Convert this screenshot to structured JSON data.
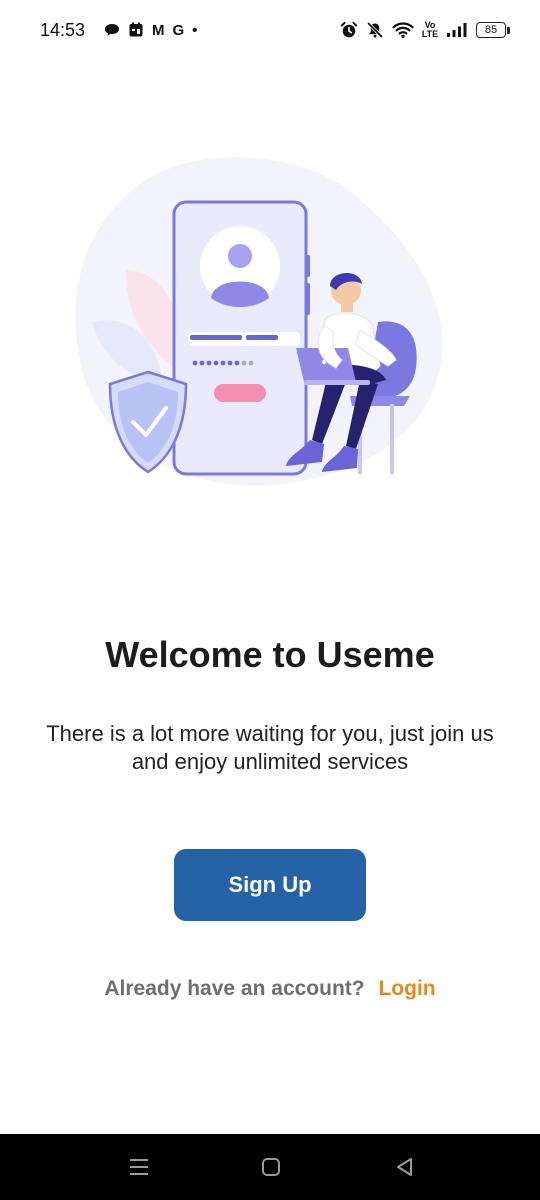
{
  "status_bar": {
    "time": "14:53",
    "left_icons": [
      "chat-bubble-icon",
      "calendar-app-icon",
      "gmail-icon",
      "google-icon",
      "dot-icon"
    ],
    "gmail_glyph": "M",
    "google_glyph": "G",
    "dot_glyph": "•",
    "right_icons": [
      "alarm-icon",
      "mute-icon",
      "wifi-icon",
      "volte-icon",
      "signal-icon",
      "battery-icon"
    ],
    "volte_label": "Vo LTE",
    "battery_level": "85"
  },
  "welcome": {
    "title": "Welcome to Useme",
    "subtitle": "There is a lot more waiting for you, just join us and enjoy unlimited services"
  },
  "actions": {
    "signup_label": "Sign Up",
    "login_prompt": "Already have an account?",
    "login_label": "Login"
  },
  "colors": {
    "primary": "#2563a6",
    "accent": "#e8891c",
    "illustration_purple": "#7b78e0",
    "illustration_pink": "#f48fb1"
  },
  "nav_bar": {
    "icons": [
      "recents-icon",
      "home-icon",
      "back-icon"
    ]
  }
}
